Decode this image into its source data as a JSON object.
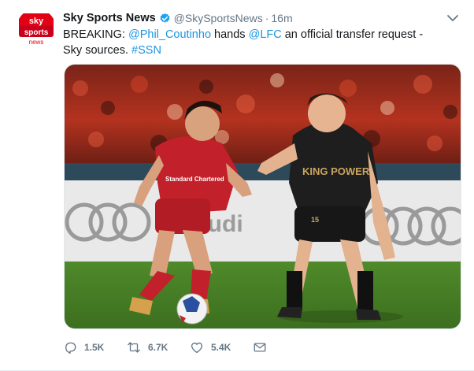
{
  "tweet": {
    "author": {
      "display_name": "Sky Sports News",
      "handle": "@SkySportsNews",
      "verified": true,
      "avatar": {
        "line1": "sky",
        "line2": "sports",
        "line3": "news",
        "brand_color": "#e10014"
      }
    },
    "separator": "·",
    "timestamp": "16m",
    "text": {
      "part1": "BREAKING: ",
      "mention1": "@Phil_Coutinho",
      "part2": " hands ",
      "mention2": "@LFC",
      "part3": " an official transfer request - Sky sources. ",
      "hashtag": "#SSN"
    },
    "media": {
      "kind": "photo",
      "shirt_text_left": "Standard Chartered",
      "shirt_text_right": "KING POWER",
      "board_text": "Audi",
      "shorts_number": "15"
    },
    "actions": {
      "reply_count": "1.5K",
      "retweet_count": "6.7K",
      "like_count": "5.4K"
    },
    "colors": {
      "link": "#1b95e0",
      "secondary": "#657786",
      "verified": "#1da1f2"
    },
    "icons": [
      "verified-badge-icon",
      "caret-down-icon",
      "reply-icon",
      "retweet-icon",
      "like-icon",
      "direct-message-icon"
    ]
  }
}
